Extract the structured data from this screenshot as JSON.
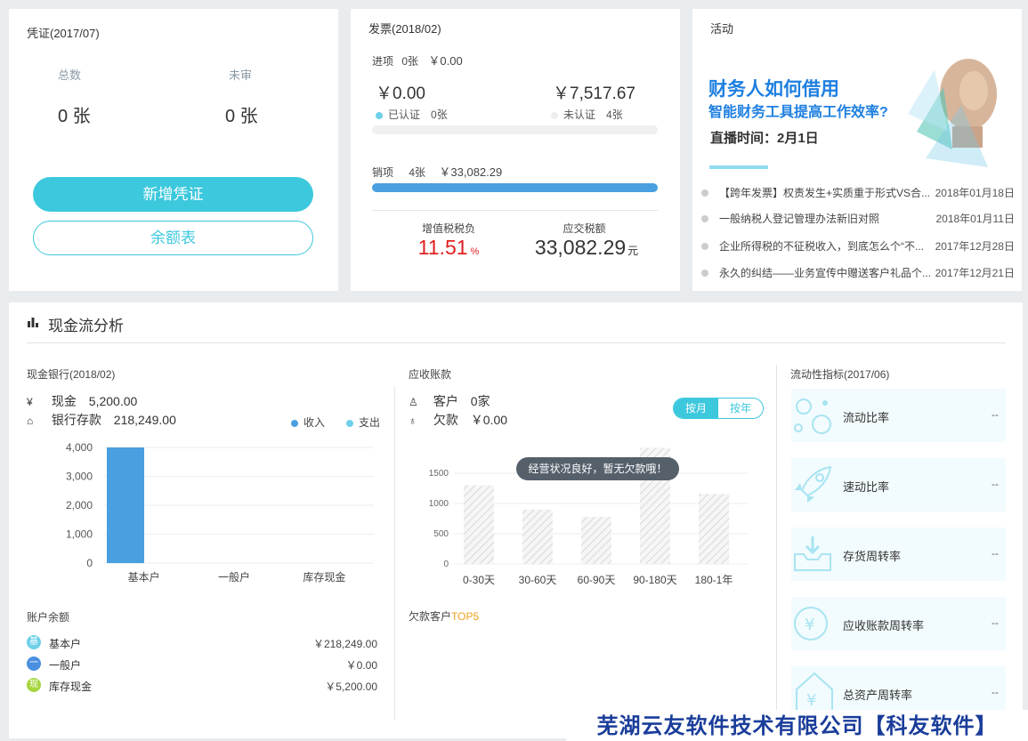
{
  "voucher": {
    "title": "凭证(2017/07)",
    "total_label": "总数",
    "total_value": "0 张",
    "unreviewed_label": "未审",
    "unreviewed_value": "0 张",
    "add_button": "新增凭证",
    "balance_button": "余额表"
  },
  "invoice": {
    "title": "发票(2018/02)",
    "input_label": "进项",
    "input_count": "0张",
    "input_amount": "￥0.00",
    "certified_amount": "￥0.00",
    "certified_label": "已认证",
    "certified_count": "0张",
    "uncertified_amount": "￥7,517.67",
    "uncertified_label": "未认证",
    "uncertified_count": "4张",
    "input_progress": 0,
    "output_label": "销项",
    "output_count": "4张",
    "output_amount": "￥33,082.29",
    "output_progress": 1,
    "vat_burden_label": "增值税税负",
    "vat_burden_value": "11.51",
    "vat_burden_unit": "%",
    "tax_payable_label": "应交税额",
    "tax_payable_value": "33,082.29",
    "tax_payable_unit": "元",
    "colors": {
      "certified": "#6fd0e8",
      "uncertified": "#eeeeee",
      "progress": "#4a9fe0",
      "burden": "#e02020"
    }
  },
  "activity": {
    "title": "活动",
    "banner": {
      "line1": "财务人如何借用",
      "line2": "智能财务工具提高工作效率?",
      "line3": "直播时间：2月1日"
    },
    "news": [
      {
        "title": "【跨年发票】权责发生+实质重于形式VS合...",
        "date": "2018年01月18日"
      },
      {
        "title": "一般纳税人登记管理办法新旧对照",
        "date": "2018年01月11日"
      },
      {
        "title": "企业所得税的不征税收入，到底怎么个“不...",
        "date": "2017年12月28日"
      },
      {
        "title": "永久的纠结——业务宣传中赠送客户礼品个...",
        "date": "2017年12月21日"
      }
    ]
  },
  "cash": {
    "title": "现金流分析",
    "bank": {
      "title": "现金银行(2018/02)",
      "cash_label": "现金",
      "cash_value": "5,200.00",
      "deposit_label": "银行存款",
      "deposit_value": "218,249.00",
      "legend_income": "收入",
      "legend_expense": "支出"
    },
    "account_balance": {
      "title": "账户余额",
      "items": [
        {
          "icon_char": "基",
          "name": "基本户",
          "value": "￥218,249.00",
          "color": "#6fd0e8"
        },
        {
          "icon_char": "一",
          "name": "一般户",
          "value": "￥0.00",
          "color": "#4a8fe0"
        },
        {
          "icon_char": "现",
          "name": "库存现金",
          "value": "￥5,200.00",
          "color": "#a5d63f"
        }
      ]
    },
    "receivable": {
      "title": "应收账款",
      "customer_label": "客户",
      "customer_value": "0家",
      "debt_label": "欠款",
      "debt_value": "￥0.00",
      "toggle_month": "按月",
      "toggle_year": "按年",
      "tooltip": "经营状况良好，暂无欠款哦！",
      "top5_label": "欠款客户",
      "top5_highlight": "TOP5"
    },
    "liquidity": {
      "title": "流动性指标(2017/06)",
      "items": [
        {
          "label": "流动比率",
          "value": "--",
          "icon": "bubbles-icon"
        },
        {
          "label": "速动比率",
          "value": "--",
          "icon": "rocket-icon"
        },
        {
          "label": "存货周转率",
          "value": "--",
          "icon": "inbox-icon"
        },
        {
          "label": "应收账款周转率",
          "value": "--",
          "icon": "yen-coin-icon"
        },
        {
          "label": "总资产周转率",
          "value": "--",
          "icon": "yen-tag-icon"
        }
      ]
    }
  },
  "chart_data": [
    {
      "type": "bar",
      "categories": [
        "基本户",
        "一般户",
        "库存现金"
      ],
      "series": [
        {
          "name": "收入",
          "values": [
            4000,
            0,
            0
          ],
          "color": "#4a9fe0"
        },
        {
          "name": "支出",
          "values": [
            0,
            0,
            0
          ],
          "color": "#6fd0e8"
        }
      ],
      "yticks": [
        "4,000",
        "3,000",
        "2,000",
        "1,000",
        "0"
      ],
      "ylim": [
        0,
        4000
      ],
      "legend": "top-right"
    },
    {
      "type": "bar",
      "categories": [
        "0-30天",
        "30-60天",
        "60-90天",
        "90-180天",
        "180-1年"
      ],
      "values": [
        1300,
        900,
        780,
        1920,
        1160
      ],
      "yticks": [
        "1500",
        "1000",
        "500",
        "0"
      ],
      "ylim": [
        0,
        2000
      ],
      "grid": true
    }
  ],
  "footer": {
    "banner_text": "芜湖云友软件技术有限公司【科友软件】"
  }
}
